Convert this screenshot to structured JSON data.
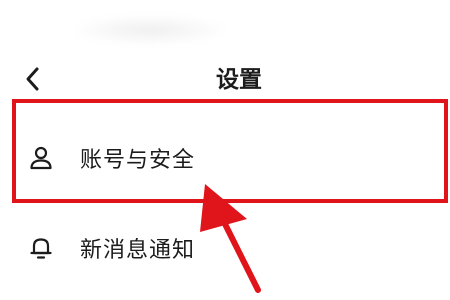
{
  "header": {
    "title": "设置",
    "back_icon": "chevron-left-icon"
  },
  "settings": {
    "items": [
      {
        "label": "账号与安全",
        "icon": "user-icon"
      },
      {
        "label": "新消息通知",
        "icon": "bell-icon"
      }
    ]
  },
  "annotation": {
    "color": "#e0151b"
  }
}
